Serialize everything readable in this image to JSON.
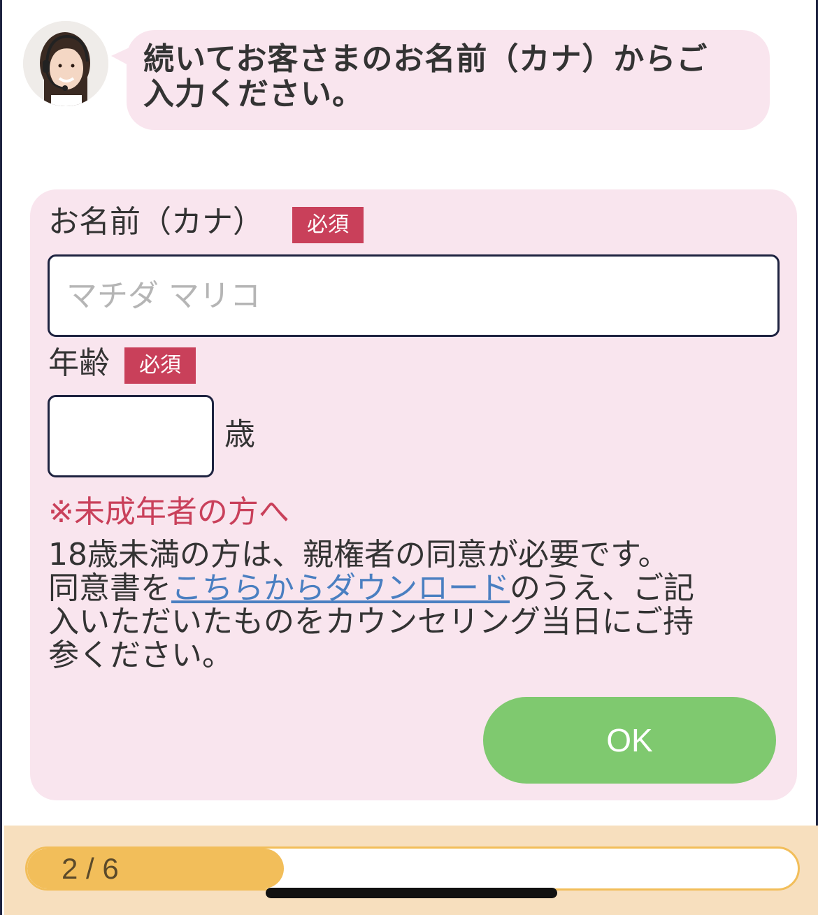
{
  "chat": {
    "operator_avatar": "operator-headset-photo",
    "message_line1": "続いてお客さまのお名前（カナ）からご",
    "message_line2": "入力ください。"
  },
  "form": {
    "name_label": "お名前（カナ）",
    "name_required": "必須",
    "name_placeholder": "マチダ マリコ",
    "name_value": "",
    "age_label": "年齢",
    "age_required": "必須",
    "age_value": "",
    "age_unit": "歳",
    "notice_title": "※未成年者の方へ",
    "notice_line1": "18歳未満の方は、親権者の同意が必要です。",
    "notice_pre_link": "同意書を",
    "notice_link": "こちらからダウンロード",
    "notice_post_link": "のうえ、ご記",
    "notice_line3": "入いただいたものをカウンセリング当日にご持",
    "notice_line4": "参ください。",
    "ok_label": "OK"
  },
  "progress": {
    "label": "2 / 6",
    "current": 2,
    "total": 6
  },
  "colors": {
    "bubble_bg": "#f9e5ee",
    "required_badge": "#c9405a",
    "ok_button": "#7fc96f",
    "progress_fill": "#f2be5a",
    "footer_bg": "#f7dfbe",
    "link": "#4a7fc1"
  }
}
